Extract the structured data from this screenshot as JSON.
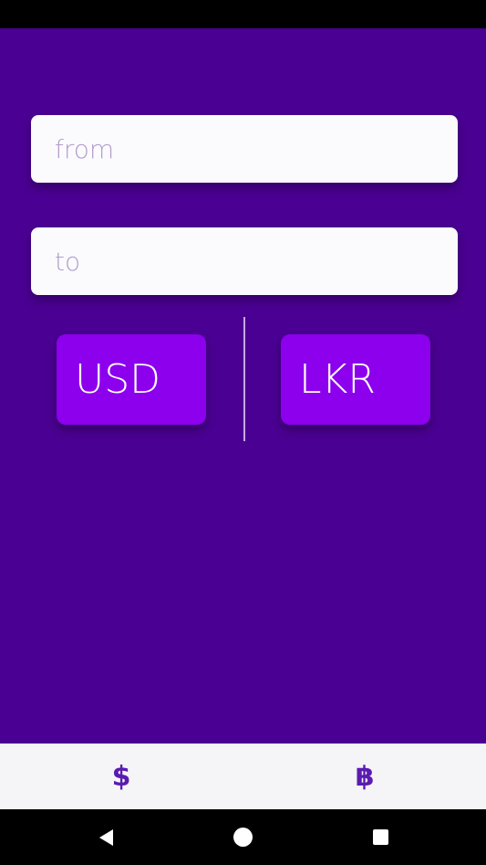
{
  "form": {
    "from_placeholder": "from",
    "from_value": "",
    "to_placeholder": "to",
    "to_value": ""
  },
  "currencies": {
    "from_label": "USD",
    "to_label": "LKR"
  },
  "bottom_nav": {
    "items": [
      {
        "icon": "dollar-icon",
        "glyph": "$"
      },
      {
        "icon": "bitcoin-icon",
        "glyph": "฿"
      }
    ]
  },
  "colors": {
    "background": "#4a0092",
    "button": "#8c00ee",
    "nav_icon": "#5a1bb0"
  }
}
